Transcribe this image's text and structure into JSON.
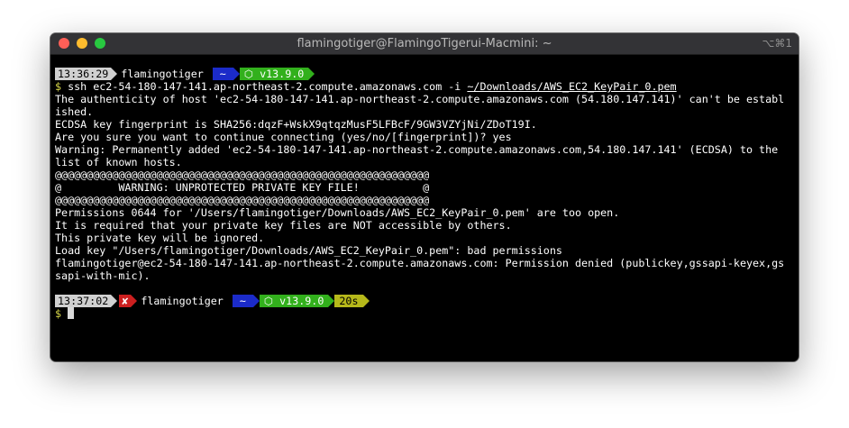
{
  "window": {
    "title": "flamingotiger@FlamingoTigerui-Macmini: ~",
    "shortcut": "⌥⌘1"
  },
  "prompt1": {
    "time": "13:36:29",
    "user": "flamingotiger",
    "dir": "~",
    "node": "⬡ v13.9.0"
  },
  "command": {
    "symbol": "$",
    "text": " ssh ec2-54-180-147-141.ap-northeast-2.compute.amazonaws.com -i ",
    "key_path": "~/Downloads/AWS_EC2_KeyPair_0.pem"
  },
  "output": [
    "The authenticity of host 'ec2-54-180-147-141.ap-northeast-2.compute.amazonaws.com (54.180.147.141)' can't be establ",
    "ished.",
    "ECDSA key fingerprint is SHA256:dqzF+WskX9qtqzMusF5LFBcF/9GW3VZYjNi/ZDoT19I.",
    "Are you sure you want to continue connecting (yes/no/[fingerprint])? yes",
    "Warning: Permanently added 'ec2-54-180-147-141.ap-northeast-2.compute.amazonaws.com,54.180.147.141' (ECDSA) to the",
    "list of known hosts.",
    "@@@@@@@@@@@@@@@@@@@@@@@@@@@@@@@@@@@@@@@@@@@@@@@@@@@@@@@@@@@",
    "@         WARNING: UNPROTECTED PRIVATE KEY FILE!          @",
    "@@@@@@@@@@@@@@@@@@@@@@@@@@@@@@@@@@@@@@@@@@@@@@@@@@@@@@@@@@@",
    "Permissions 0644 for '/Users/flamingotiger/Downloads/AWS_EC2_KeyPair_0.pem' are too open.",
    "It is required that your private key files are NOT accessible by others.",
    "This private key will be ignored.",
    "Load key \"/Users/flamingotiger/Downloads/AWS_EC2_KeyPair_0.pem\": bad permissions",
    "flamingotiger@ec2-54-180-147-141.ap-northeast-2.compute.amazonaws.com: Permission denied (publickey,gssapi-keyex,gs",
    "sapi-with-mic)."
  ],
  "prompt2": {
    "time": "13:37:02",
    "fail_mark": "✘",
    "user": "flamingotiger",
    "dir": "~",
    "node": "⬡ v13.9.0",
    "duration": "20s",
    "symbol": "$"
  },
  "colors": {
    "terminal_bg": "#000000",
    "titlebar_bg": "#333336",
    "dir_segment": "#1b2bc9",
    "node_segment": "#32b01c",
    "duration_segment": "#b6b81a",
    "fail_segment": "#cc1f1f",
    "time_segment": "#d0d0d0",
    "prompt_symbol": "#d8d84a"
  }
}
